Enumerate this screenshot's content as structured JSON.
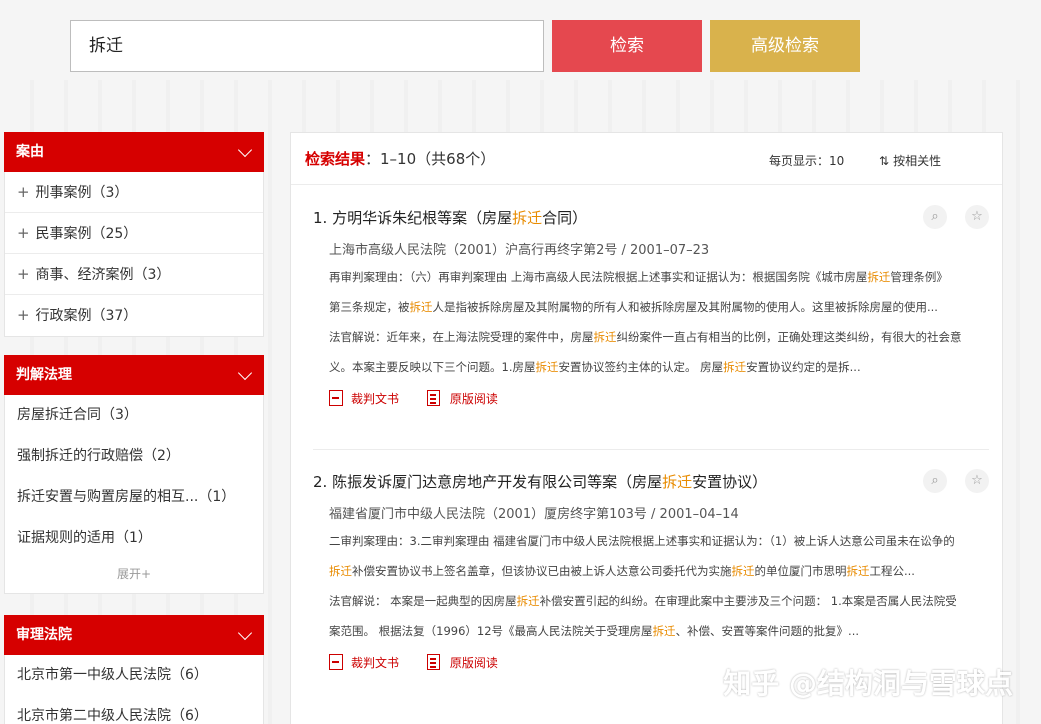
{
  "search": {
    "query": "拆迁",
    "search_label": "检索",
    "advanced_label": "高级检索"
  },
  "sidebar": {
    "case_type": {
      "title": "案由",
      "items": [
        {
          "label": "刑事案例（3）"
        },
        {
          "label": "民事案例（25）"
        },
        {
          "label": "商事、经济案例（3）"
        },
        {
          "label": "行政案例（37）"
        }
      ]
    },
    "legal_reasoning": {
      "title": "判解法理",
      "items": [
        {
          "label": "房屋拆迁合同（3）"
        },
        {
          "label": "强制拆迁的行政赔偿（2）"
        },
        {
          "label": "拆迁安置与购置房屋的相互...（1）"
        },
        {
          "label": "证据规则的适用（1）"
        }
      ],
      "expand_label": "展开+"
    },
    "court": {
      "title": "审理法院",
      "items": [
        {
          "label": "北京市第一中级人民法院（6）"
        },
        {
          "label": "北京市第二中级人民法院（6）"
        }
      ]
    }
  },
  "results": {
    "label": "检索结果",
    "range": "：1–10（共68个）",
    "per_page": "每页显示：10",
    "sort_label": "按相关性",
    "cases": [
      {
        "title_pre": "1. 方明华诉朱纪根等案（房屋",
        "title_hl": "拆迁",
        "title_post": "合同）",
        "court": "上海市高级人民法院（2001）沪高行再终字第2号 / 2001–07–23",
        "lines": [
          [
            {
              "t": "再审判案理由：（六）再审判案理由 上海市高级人民法院根据上述事实和证据认为：根据国务院《城市房屋"
            },
            {
              "t": "拆迁",
              "h": true
            },
            {
              "t": "管理条例》"
            }
          ],
          [
            {
              "t": "第三条规定，被"
            },
            {
              "t": "拆迁",
              "h": true
            },
            {
              "t": "人是指被拆除房屋及其附属物的所有人和被拆除房屋及其附属物的使用人。这里被拆除房屋的使用..."
            }
          ],
          [
            {
              "t": "法官解说：近年来，在上海法院受理的案件中，房屋"
            },
            {
              "t": "拆迁",
              "h": true
            },
            {
              "t": "纠纷案件一直占有相当的比例，正确处理这类纠纷，有很大的社会意"
            }
          ],
          [
            {
              "t": "义。本案主要反映以下三个问题。1.房屋"
            },
            {
              "t": "拆迁",
              "h": true
            },
            {
              "t": "安置协议签约主体的认定。 房屋"
            },
            {
              "t": "拆迁",
              "h": true
            },
            {
              "t": "安置协议约定的是拆..."
            }
          ]
        ]
      },
      {
        "title_pre": "2. 陈振发诉厦门达意房地产开发有限公司等案（房屋",
        "title_hl": "拆迁",
        "title_post": "安置协议）",
        "court": "福建省厦门市中级人民法院（2001）厦房终字第103号 / 2001–04–14",
        "lines": [
          [
            {
              "t": "二审判案理由：3.二审判案理由 福建省厦门市中级人民法院根据上述事实和证据认为：（1）被上诉人达意公司虽未在讼争的"
            }
          ],
          [
            {
              "t": "拆迁",
              "h": true
            },
            {
              "t": "补偿安置协议书上签名盖章，但该协议已由被上诉人达意公司委托代为实施"
            },
            {
              "t": "拆迁",
              "h": true
            },
            {
              "t": "的单位厦门市思明"
            },
            {
              "t": "拆迁",
              "h": true
            },
            {
              "t": "工程公..."
            }
          ],
          [
            {
              "t": "法官解说： 本案是一起典型的因房屋"
            },
            {
              "t": "拆迁",
              "h": true
            },
            {
              "t": "补偿安置引起的纠纷。在审理此案中主要涉及三个问题： 1.本案是否属人民法院受"
            }
          ],
          [
            {
              "t": "案范围。 根据法复（1996）12号《最高人民法院关于受理房屋"
            },
            {
              "t": "拆迁",
              "h": true
            },
            {
              "t": "、补偿、安置等案件问题的批复》..."
            }
          ]
        ]
      }
    ],
    "link_judgment": "裁判文书",
    "link_original": "原版阅读"
  },
  "watermark": "知乎 @结构洞与雪球点"
}
